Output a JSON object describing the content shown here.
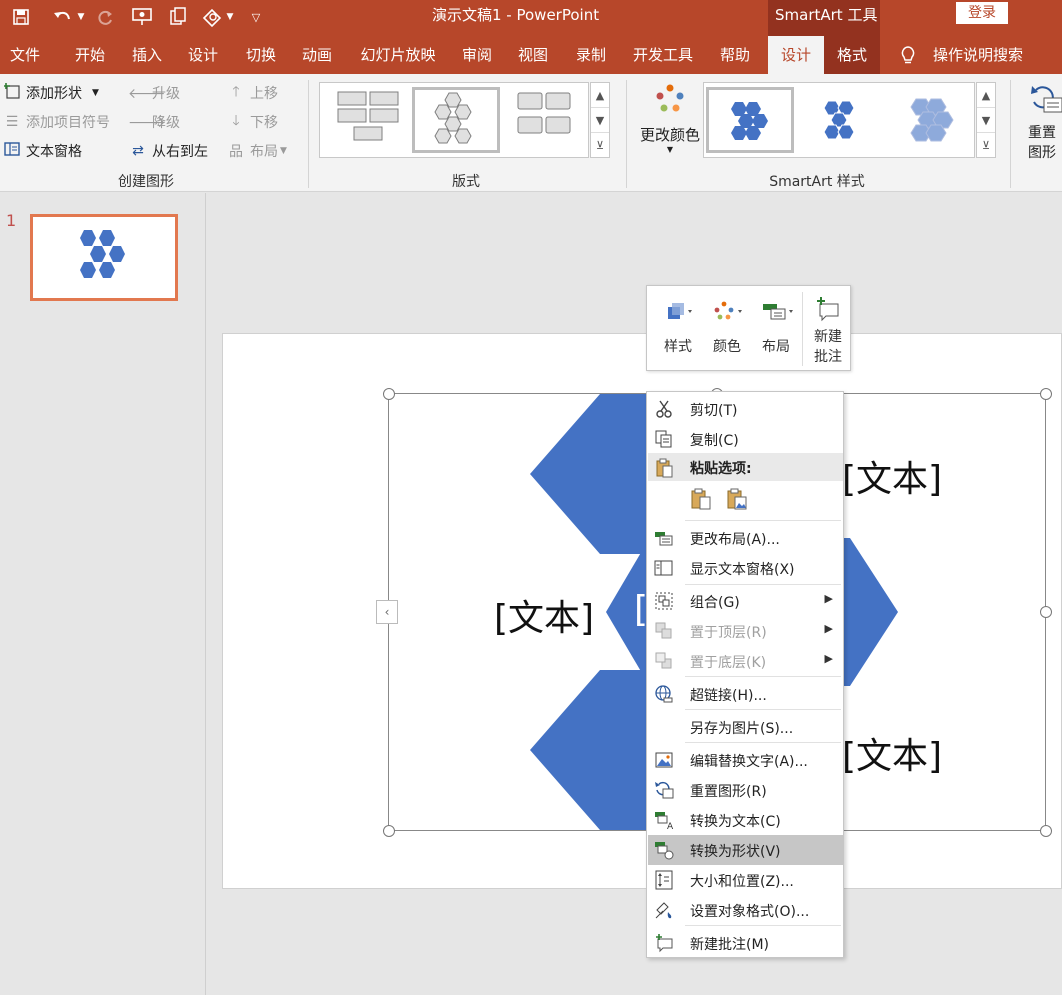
{
  "titlebar": {
    "title": "演示文稿1 - PowerPoint",
    "context_tools": "SmartArt 工具",
    "login": "登录",
    "qa_icons": [
      "save-icon",
      "undo-icon",
      "dropdown-icon",
      "redo-icon",
      "present-icon",
      "copy-icon",
      "shapes-icon",
      "dropdown-icon",
      "customize-icon"
    ]
  },
  "tabs": [
    "文件",
    "开始",
    "插入",
    "设计",
    "切换",
    "动画",
    "幻灯片放映",
    "审阅",
    "视图",
    "录制",
    "开发工具",
    "帮助",
    "设计",
    "格式"
  ],
  "tell_me": "操作说明搜索",
  "ribbon": {
    "create": {
      "label": "创建图形",
      "add_shape": "添加形状",
      "add_bullet": "添加项目符号",
      "text_pane": "文本窗格",
      "promote": "升级",
      "demote": "降级",
      "rtl": "从右到左",
      "move_up": "上移",
      "move_down": "下移",
      "layout": "布局"
    },
    "layouts": {
      "label": "版式"
    },
    "styles": {
      "label": "SmartArt 样式",
      "change_colors": "更改颜色"
    },
    "reset": {
      "label1": "重置",
      "label2": "图形"
    }
  },
  "thumbnails": {
    "slide_number": "1"
  },
  "slide": {
    "texts": [
      "[文本]",
      "[文本]",
      "[文本]",
      "[文本]",
      "["
    ]
  },
  "mini_toolbar": {
    "style": "样式",
    "color": "颜色",
    "layout": "布局",
    "new_comment_1": "新建",
    "new_comment_2": "批注"
  },
  "context_menu": {
    "items": [
      {
        "label": "剪切(T)",
        "icon": "scissors-icon"
      },
      {
        "label": "复制(C)",
        "icon": "copy-icon"
      },
      {
        "label": "粘贴选项:",
        "icon": "paste-icon"
      },
      {
        "label": "更改布局(A)...",
        "icon": "layout-icon"
      },
      {
        "label": "显示文本窗格(X)",
        "icon": "text-pane-icon"
      },
      {
        "label": "组合(G)",
        "icon": "group-icon"
      },
      {
        "label": "置于顶层(R)",
        "icon": "bring-front-icon"
      },
      {
        "label": "置于底层(K)",
        "icon": "send-back-icon"
      },
      {
        "label": "超链接(H)...",
        "icon": "hyperlink-icon"
      },
      {
        "label": "另存为图片(S)...",
        "icon": ""
      },
      {
        "label": "编辑替换文字(A)...",
        "icon": "alt-text-icon"
      },
      {
        "label": "重置图形(R)",
        "icon": "reset-graphic-icon"
      },
      {
        "label": "转换为文本(C)",
        "icon": "convert-text-icon"
      },
      {
        "label": "转换为形状(V)",
        "icon": "convert-shapes-icon"
      },
      {
        "label": "大小和位置(Z)...",
        "icon": "size-position-icon"
      },
      {
        "label": "设置对象格式(O)...",
        "icon": "format-object-icon"
      },
      {
        "label": "新建批注(M)",
        "icon": "comment-icon"
      }
    ]
  },
  "colors": {
    "accent": "#b7472a",
    "context_tab": "#93321f",
    "hexagon": "#4472c4"
  }
}
